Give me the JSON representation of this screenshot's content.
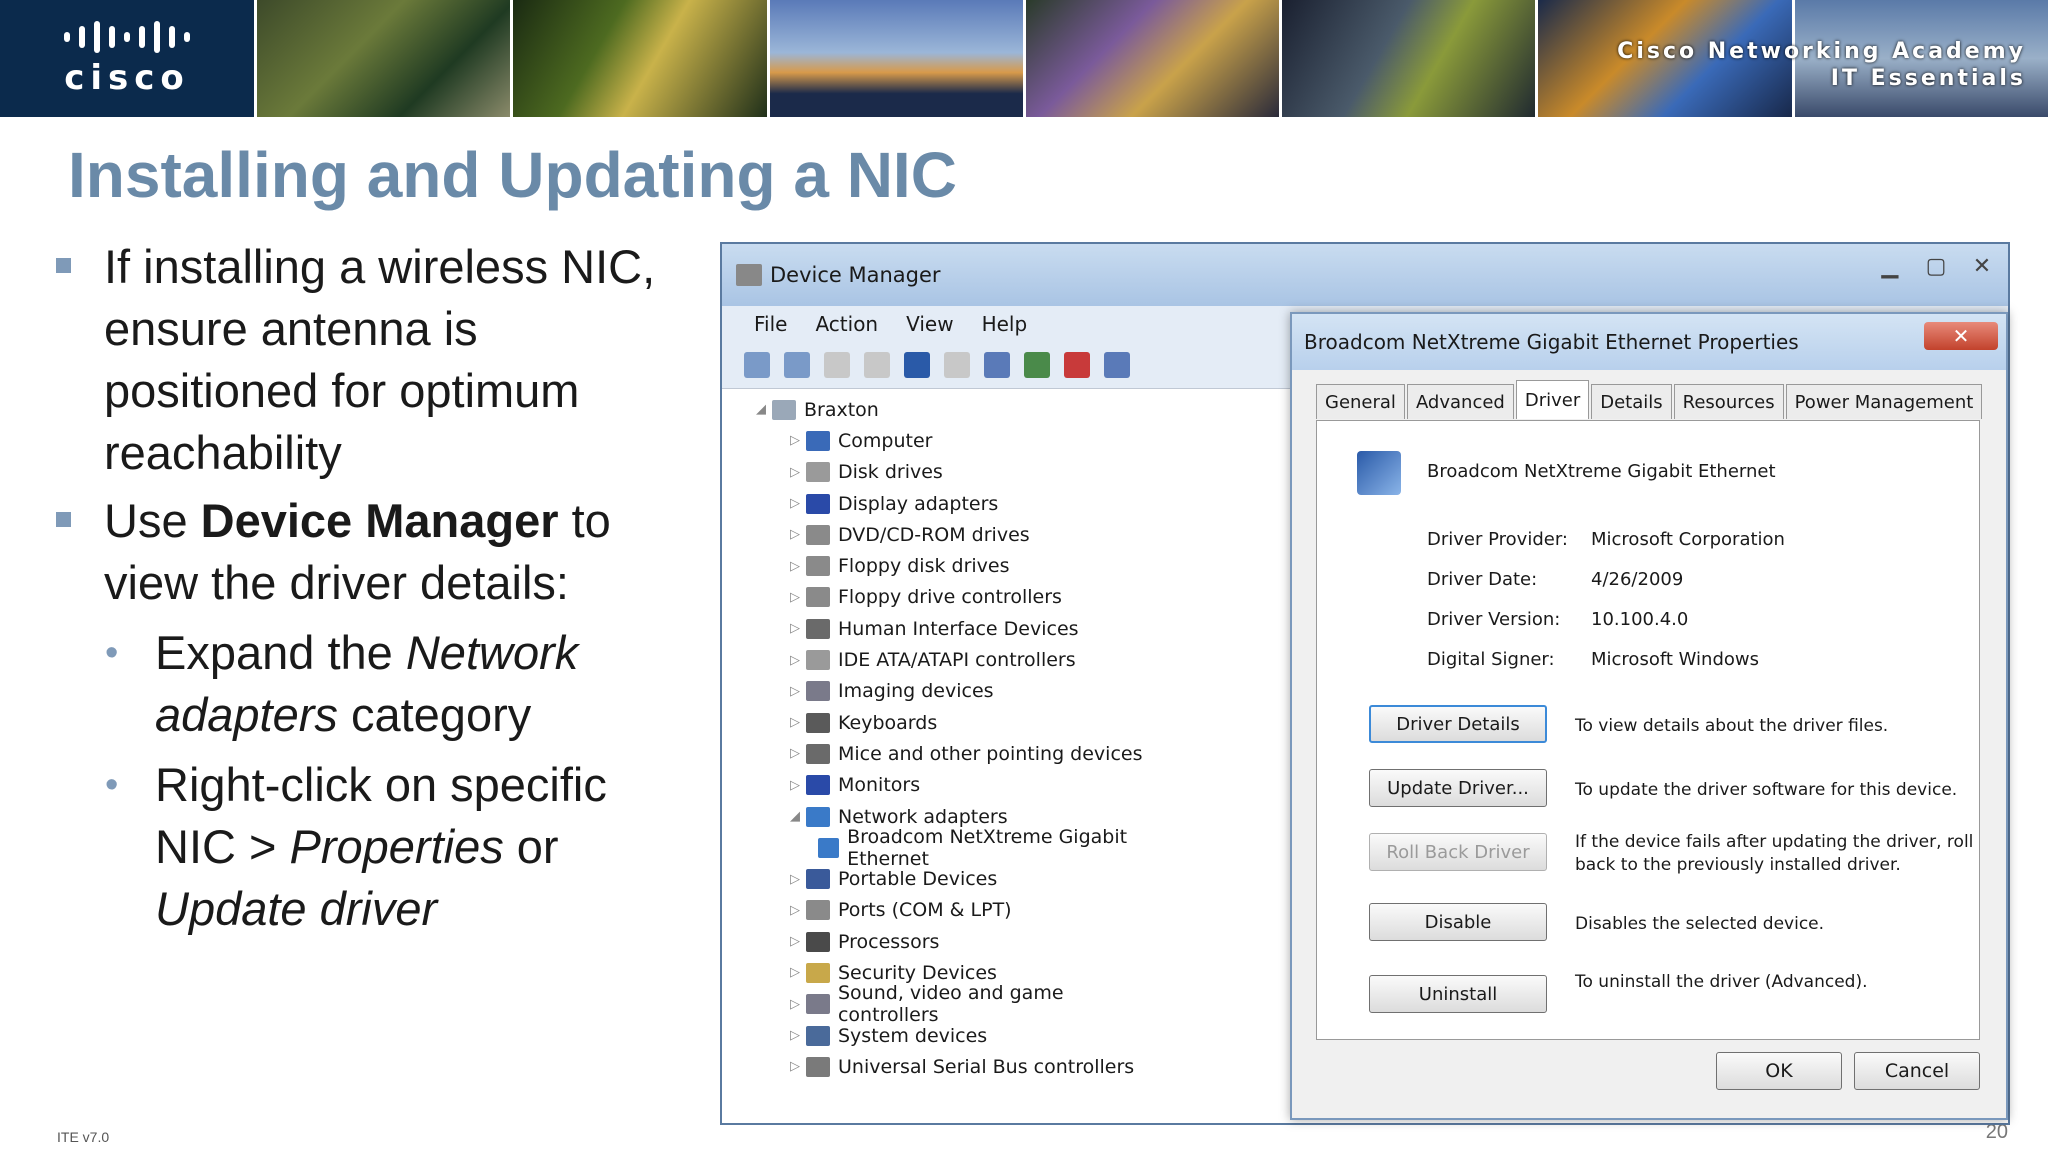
{
  "banner": {
    "logo_text": "cisco",
    "caption_line1": "Cisco Networking Academy",
    "caption_line2": "IT Essentials"
  },
  "slide": {
    "title": "Installing and Updating a NIC",
    "bullet1": "If installing a wireless NIC, ensure antenna is positioned for optimum reachability",
    "bullet2_pre": "Use ",
    "bullet2_bold": "Device Manager",
    "bullet2_post": " to view the driver details:",
    "sub1_pre": "Expand the ",
    "sub1_italic": "Network adapters",
    "sub1_post": " category",
    "sub2_pre": "Right-click on specific NIC > ",
    "sub2_italic1": "Properties",
    "sub2_mid": " or ",
    "sub2_italic2": "Update driver",
    "footer_left": "ITE v7.0",
    "page_number": "20"
  },
  "device_manager": {
    "title": "Device Manager",
    "menu": [
      "File",
      "Action",
      "View",
      "Help"
    ],
    "tree_root": "Braxton",
    "tree_items": [
      "Computer",
      "Disk drives",
      "Display adapters",
      "DVD/CD-ROM drives",
      "Floppy disk drives",
      "Floppy drive controllers",
      "Human Interface Devices",
      "IDE ATA/ATAPI controllers",
      "Imaging devices",
      "Keyboards",
      "Mice and other pointing devices",
      "Monitors",
      "Network adapters",
      "Broadcom NetXtreme Gigabit Ethernet",
      "Portable Devices",
      "Ports (COM & LPT)",
      "Processors",
      "Security Devices",
      "Sound, video and game controllers",
      "System devices",
      "Universal Serial Bus controllers"
    ]
  },
  "properties": {
    "title": "Broadcom NetXtreme Gigabit Ethernet Properties",
    "tabs": [
      "General",
      "Advanced",
      "Driver",
      "Details",
      "Resources",
      "Power Management"
    ],
    "active_tab": "Driver",
    "device_name": "Broadcom NetXtreme Gigabit Ethernet",
    "driver_provider_label": "Driver Provider:",
    "driver_provider": "Microsoft Corporation",
    "driver_date_label": "Driver Date:",
    "driver_date": "4/26/2009",
    "driver_version_label": "Driver Version:",
    "driver_version": "10.100.4.0",
    "digital_signer_label": "Digital Signer:",
    "digital_signer": "Microsoft Windows",
    "buttons": {
      "driver_details": "Driver Details",
      "update_driver": "Update Driver...",
      "roll_back": "Roll Back Driver",
      "disable": "Disable",
      "uninstall": "Uninstall",
      "ok": "OK",
      "cancel": "Cancel"
    },
    "descriptions": {
      "driver_details": "To view details about the driver files.",
      "update_driver": "To update the driver software for this device.",
      "roll_back": "If the device fails after updating the driver, roll back to the previously installed driver.",
      "disable": "Disables the selected device.",
      "uninstall": "To uninstall the driver (Advanced)."
    }
  }
}
